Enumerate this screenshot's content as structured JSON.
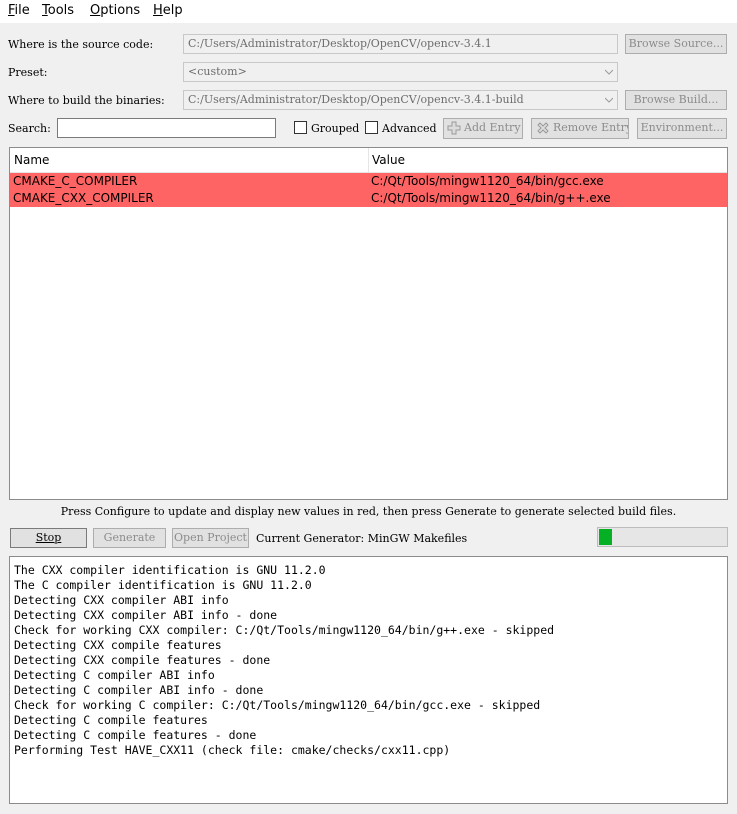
{
  "menubar": {
    "items": [
      {
        "key": "F",
        "rest": "ile"
      },
      {
        "key": "T",
        "rest": "ools"
      },
      {
        "key": "O",
        "rest": "ptions"
      },
      {
        "key": "H",
        "rest": "elp"
      }
    ]
  },
  "source": {
    "label": "Where is the source code:",
    "value": "C:/Users/Administrator/Desktop/OpenCV/opencv-3.4.1",
    "browse_label": "Browse Source..."
  },
  "preset": {
    "label": "Preset:",
    "value": "<custom>"
  },
  "build": {
    "label": "Where to build the binaries:",
    "value": "C:/Users/Administrator/Desktop/OpenCV/opencv-3.4.1-build",
    "browse_label": "Browse Build..."
  },
  "search": {
    "label": "Search:",
    "value": "",
    "grouped_label": "Grouped",
    "advanced_label": "Advanced",
    "add_entry_label": "Add Entry",
    "remove_entry_label": "Remove Entry",
    "environment_label": "Environment..."
  },
  "table": {
    "headers": [
      "Name",
      "Value"
    ],
    "rows": [
      {
        "name": "CMAKE_C_COMPILER",
        "value": "C:/Qt/Tools/mingw1120_64/bin/gcc.exe"
      },
      {
        "name": "CMAKE_CXX_COMPILER",
        "value": "C:/Qt/Tools/mingw1120_64/bin/g++.exe"
      }
    ],
    "highlight_color": "#ff6464"
  },
  "hint": "Press Configure to update and display new values in red, then press Generate to generate selected build files.",
  "actions": {
    "stop_label": "Stop",
    "generate_label": "Generate",
    "open_project_label": "Open Project",
    "generator_text": "Current Generator: MinGW Makefiles"
  },
  "progress": {
    "fraction": 0.1,
    "color": "#06b025"
  },
  "log": {
    "lines": [
      "The CXX compiler identification is GNU 11.2.0",
      "The C compiler identification is GNU 11.2.0",
      "Detecting CXX compiler ABI info",
      "Detecting CXX compiler ABI info - done",
      "Check for working CXX compiler: C:/Qt/Tools/mingw1120_64/bin/g++.exe - skipped",
      "Detecting CXX compile features",
      "Detecting CXX compile features - done",
      "Detecting C compiler ABI info",
      "Detecting C compiler ABI info - done",
      "Check for working C compiler: C:/Qt/Tools/mingw1120_64/bin/gcc.exe - skipped",
      "Detecting C compile features",
      "Detecting C compile features - done",
      "Performing Test HAVE_CXX11 (check file: cmake/checks/cxx11.cpp)"
    ]
  }
}
